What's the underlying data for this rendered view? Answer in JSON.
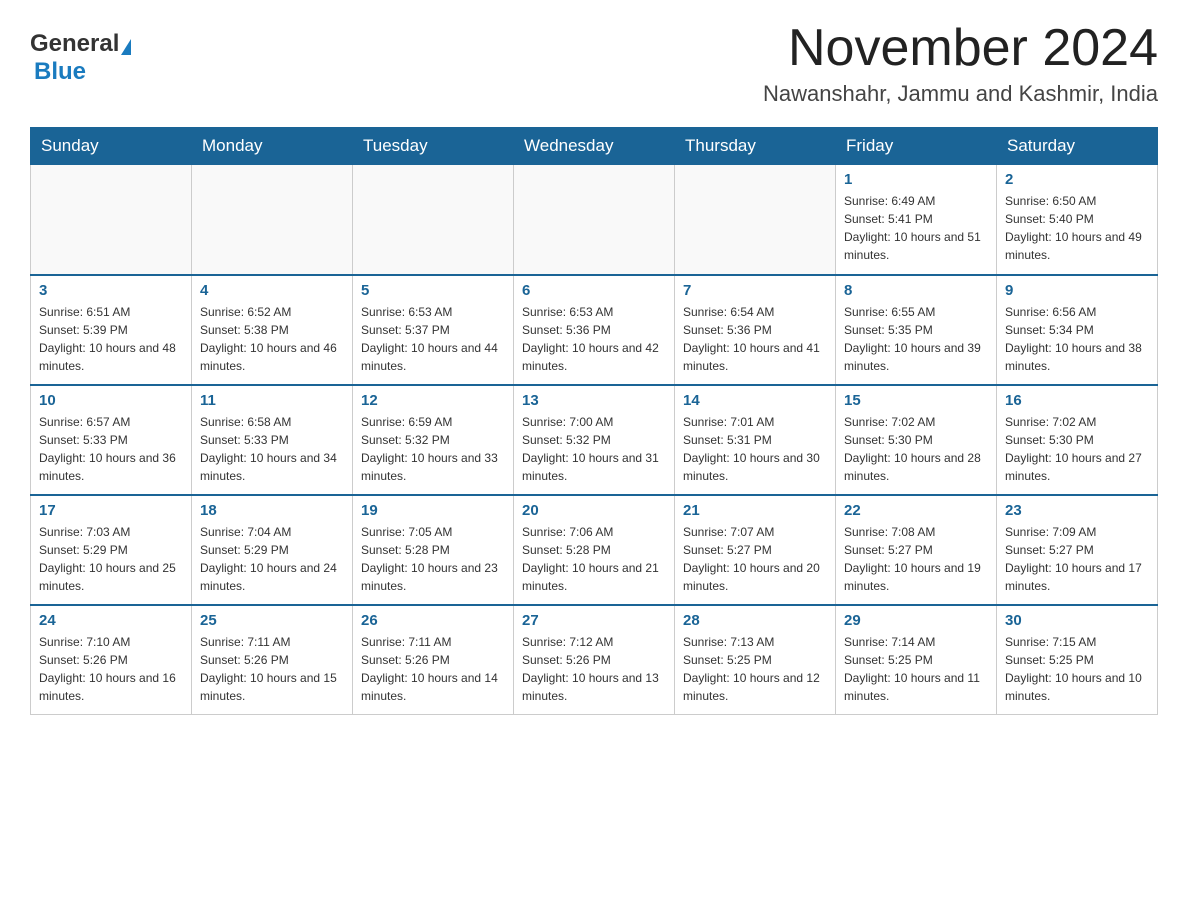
{
  "logo": {
    "general": "General",
    "blue": "Blue"
  },
  "title": "November 2024",
  "location": "Nawanshahr, Jammu and Kashmir, India",
  "weekdays": [
    "Sunday",
    "Monday",
    "Tuesday",
    "Wednesday",
    "Thursday",
    "Friday",
    "Saturday"
  ],
  "weeks": [
    [
      {
        "day": "",
        "info": ""
      },
      {
        "day": "",
        "info": ""
      },
      {
        "day": "",
        "info": ""
      },
      {
        "day": "",
        "info": ""
      },
      {
        "day": "",
        "info": ""
      },
      {
        "day": "1",
        "info": "Sunrise: 6:49 AM\nSunset: 5:41 PM\nDaylight: 10 hours and 51 minutes."
      },
      {
        "day": "2",
        "info": "Sunrise: 6:50 AM\nSunset: 5:40 PM\nDaylight: 10 hours and 49 minutes."
      }
    ],
    [
      {
        "day": "3",
        "info": "Sunrise: 6:51 AM\nSunset: 5:39 PM\nDaylight: 10 hours and 48 minutes."
      },
      {
        "day": "4",
        "info": "Sunrise: 6:52 AM\nSunset: 5:38 PM\nDaylight: 10 hours and 46 minutes."
      },
      {
        "day": "5",
        "info": "Sunrise: 6:53 AM\nSunset: 5:37 PM\nDaylight: 10 hours and 44 minutes."
      },
      {
        "day": "6",
        "info": "Sunrise: 6:53 AM\nSunset: 5:36 PM\nDaylight: 10 hours and 42 minutes."
      },
      {
        "day": "7",
        "info": "Sunrise: 6:54 AM\nSunset: 5:36 PM\nDaylight: 10 hours and 41 minutes."
      },
      {
        "day": "8",
        "info": "Sunrise: 6:55 AM\nSunset: 5:35 PM\nDaylight: 10 hours and 39 minutes."
      },
      {
        "day": "9",
        "info": "Sunrise: 6:56 AM\nSunset: 5:34 PM\nDaylight: 10 hours and 38 minutes."
      }
    ],
    [
      {
        "day": "10",
        "info": "Sunrise: 6:57 AM\nSunset: 5:33 PM\nDaylight: 10 hours and 36 minutes."
      },
      {
        "day": "11",
        "info": "Sunrise: 6:58 AM\nSunset: 5:33 PM\nDaylight: 10 hours and 34 minutes."
      },
      {
        "day": "12",
        "info": "Sunrise: 6:59 AM\nSunset: 5:32 PM\nDaylight: 10 hours and 33 minutes."
      },
      {
        "day": "13",
        "info": "Sunrise: 7:00 AM\nSunset: 5:32 PM\nDaylight: 10 hours and 31 minutes."
      },
      {
        "day": "14",
        "info": "Sunrise: 7:01 AM\nSunset: 5:31 PM\nDaylight: 10 hours and 30 minutes."
      },
      {
        "day": "15",
        "info": "Sunrise: 7:02 AM\nSunset: 5:30 PM\nDaylight: 10 hours and 28 minutes."
      },
      {
        "day": "16",
        "info": "Sunrise: 7:02 AM\nSunset: 5:30 PM\nDaylight: 10 hours and 27 minutes."
      }
    ],
    [
      {
        "day": "17",
        "info": "Sunrise: 7:03 AM\nSunset: 5:29 PM\nDaylight: 10 hours and 25 minutes."
      },
      {
        "day": "18",
        "info": "Sunrise: 7:04 AM\nSunset: 5:29 PM\nDaylight: 10 hours and 24 minutes."
      },
      {
        "day": "19",
        "info": "Sunrise: 7:05 AM\nSunset: 5:28 PM\nDaylight: 10 hours and 23 minutes."
      },
      {
        "day": "20",
        "info": "Sunrise: 7:06 AM\nSunset: 5:28 PM\nDaylight: 10 hours and 21 minutes."
      },
      {
        "day": "21",
        "info": "Sunrise: 7:07 AM\nSunset: 5:27 PM\nDaylight: 10 hours and 20 minutes."
      },
      {
        "day": "22",
        "info": "Sunrise: 7:08 AM\nSunset: 5:27 PM\nDaylight: 10 hours and 19 minutes."
      },
      {
        "day": "23",
        "info": "Sunrise: 7:09 AM\nSunset: 5:27 PM\nDaylight: 10 hours and 17 minutes."
      }
    ],
    [
      {
        "day": "24",
        "info": "Sunrise: 7:10 AM\nSunset: 5:26 PM\nDaylight: 10 hours and 16 minutes."
      },
      {
        "day": "25",
        "info": "Sunrise: 7:11 AM\nSunset: 5:26 PM\nDaylight: 10 hours and 15 minutes."
      },
      {
        "day": "26",
        "info": "Sunrise: 7:11 AM\nSunset: 5:26 PM\nDaylight: 10 hours and 14 minutes."
      },
      {
        "day": "27",
        "info": "Sunrise: 7:12 AM\nSunset: 5:26 PM\nDaylight: 10 hours and 13 minutes."
      },
      {
        "day": "28",
        "info": "Sunrise: 7:13 AM\nSunset: 5:25 PM\nDaylight: 10 hours and 12 minutes."
      },
      {
        "day": "29",
        "info": "Sunrise: 7:14 AM\nSunset: 5:25 PM\nDaylight: 10 hours and 11 minutes."
      },
      {
        "day": "30",
        "info": "Sunrise: 7:15 AM\nSunset: 5:25 PM\nDaylight: 10 hours and 10 minutes."
      }
    ]
  ]
}
